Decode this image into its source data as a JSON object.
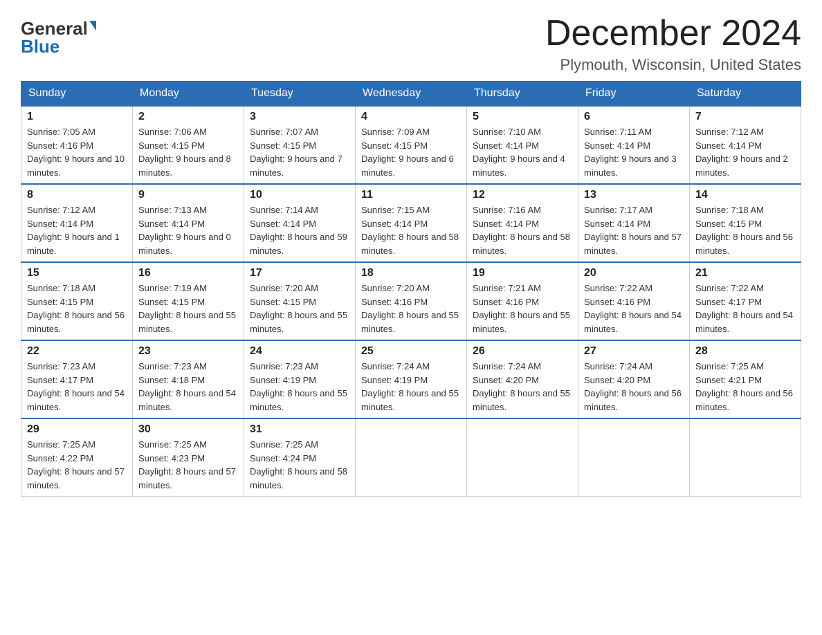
{
  "logo": {
    "general": "General",
    "blue": "Blue"
  },
  "title": {
    "month": "December 2024",
    "location": "Plymouth, Wisconsin, United States"
  },
  "headers": [
    "Sunday",
    "Monday",
    "Tuesday",
    "Wednesday",
    "Thursday",
    "Friday",
    "Saturday"
  ],
  "weeks": [
    [
      {
        "day": "1",
        "sunrise": "Sunrise: 7:05 AM",
        "sunset": "Sunset: 4:16 PM",
        "daylight": "Daylight: 9 hours and 10 minutes."
      },
      {
        "day": "2",
        "sunrise": "Sunrise: 7:06 AM",
        "sunset": "Sunset: 4:15 PM",
        "daylight": "Daylight: 9 hours and 8 minutes."
      },
      {
        "day": "3",
        "sunrise": "Sunrise: 7:07 AM",
        "sunset": "Sunset: 4:15 PM",
        "daylight": "Daylight: 9 hours and 7 minutes."
      },
      {
        "day": "4",
        "sunrise": "Sunrise: 7:09 AM",
        "sunset": "Sunset: 4:15 PM",
        "daylight": "Daylight: 9 hours and 6 minutes."
      },
      {
        "day": "5",
        "sunrise": "Sunrise: 7:10 AM",
        "sunset": "Sunset: 4:14 PM",
        "daylight": "Daylight: 9 hours and 4 minutes."
      },
      {
        "day": "6",
        "sunrise": "Sunrise: 7:11 AM",
        "sunset": "Sunset: 4:14 PM",
        "daylight": "Daylight: 9 hours and 3 minutes."
      },
      {
        "day": "7",
        "sunrise": "Sunrise: 7:12 AM",
        "sunset": "Sunset: 4:14 PM",
        "daylight": "Daylight: 9 hours and 2 minutes."
      }
    ],
    [
      {
        "day": "8",
        "sunrise": "Sunrise: 7:12 AM",
        "sunset": "Sunset: 4:14 PM",
        "daylight": "Daylight: 9 hours and 1 minute."
      },
      {
        "day": "9",
        "sunrise": "Sunrise: 7:13 AM",
        "sunset": "Sunset: 4:14 PM",
        "daylight": "Daylight: 9 hours and 0 minutes."
      },
      {
        "day": "10",
        "sunrise": "Sunrise: 7:14 AM",
        "sunset": "Sunset: 4:14 PM",
        "daylight": "Daylight: 8 hours and 59 minutes."
      },
      {
        "day": "11",
        "sunrise": "Sunrise: 7:15 AM",
        "sunset": "Sunset: 4:14 PM",
        "daylight": "Daylight: 8 hours and 58 minutes."
      },
      {
        "day": "12",
        "sunrise": "Sunrise: 7:16 AM",
        "sunset": "Sunset: 4:14 PM",
        "daylight": "Daylight: 8 hours and 58 minutes."
      },
      {
        "day": "13",
        "sunrise": "Sunrise: 7:17 AM",
        "sunset": "Sunset: 4:14 PM",
        "daylight": "Daylight: 8 hours and 57 minutes."
      },
      {
        "day": "14",
        "sunrise": "Sunrise: 7:18 AM",
        "sunset": "Sunset: 4:15 PM",
        "daylight": "Daylight: 8 hours and 56 minutes."
      }
    ],
    [
      {
        "day": "15",
        "sunrise": "Sunrise: 7:18 AM",
        "sunset": "Sunset: 4:15 PM",
        "daylight": "Daylight: 8 hours and 56 minutes."
      },
      {
        "day": "16",
        "sunrise": "Sunrise: 7:19 AM",
        "sunset": "Sunset: 4:15 PM",
        "daylight": "Daylight: 8 hours and 55 minutes."
      },
      {
        "day": "17",
        "sunrise": "Sunrise: 7:20 AM",
        "sunset": "Sunset: 4:15 PM",
        "daylight": "Daylight: 8 hours and 55 minutes."
      },
      {
        "day": "18",
        "sunrise": "Sunrise: 7:20 AM",
        "sunset": "Sunset: 4:16 PM",
        "daylight": "Daylight: 8 hours and 55 minutes."
      },
      {
        "day": "19",
        "sunrise": "Sunrise: 7:21 AM",
        "sunset": "Sunset: 4:16 PM",
        "daylight": "Daylight: 8 hours and 55 minutes."
      },
      {
        "day": "20",
        "sunrise": "Sunrise: 7:22 AM",
        "sunset": "Sunset: 4:16 PM",
        "daylight": "Daylight: 8 hours and 54 minutes."
      },
      {
        "day": "21",
        "sunrise": "Sunrise: 7:22 AM",
        "sunset": "Sunset: 4:17 PM",
        "daylight": "Daylight: 8 hours and 54 minutes."
      }
    ],
    [
      {
        "day": "22",
        "sunrise": "Sunrise: 7:23 AM",
        "sunset": "Sunset: 4:17 PM",
        "daylight": "Daylight: 8 hours and 54 minutes."
      },
      {
        "day": "23",
        "sunrise": "Sunrise: 7:23 AM",
        "sunset": "Sunset: 4:18 PM",
        "daylight": "Daylight: 8 hours and 54 minutes."
      },
      {
        "day": "24",
        "sunrise": "Sunrise: 7:23 AM",
        "sunset": "Sunset: 4:19 PM",
        "daylight": "Daylight: 8 hours and 55 minutes."
      },
      {
        "day": "25",
        "sunrise": "Sunrise: 7:24 AM",
        "sunset": "Sunset: 4:19 PM",
        "daylight": "Daylight: 8 hours and 55 minutes."
      },
      {
        "day": "26",
        "sunrise": "Sunrise: 7:24 AM",
        "sunset": "Sunset: 4:20 PM",
        "daylight": "Daylight: 8 hours and 55 minutes."
      },
      {
        "day": "27",
        "sunrise": "Sunrise: 7:24 AM",
        "sunset": "Sunset: 4:20 PM",
        "daylight": "Daylight: 8 hours and 56 minutes."
      },
      {
        "day": "28",
        "sunrise": "Sunrise: 7:25 AM",
        "sunset": "Sunset: 4:21 PM",
        "daylight": "Daylight: 8 hours and 56 minutes."
      }
    ],
    [
      {
        "day": "29",
        "sunrise": "Sunrise: 7:25 AM",
        "sunset": "Sunset: 4:22 PM",
        "daylight": "Daylight: 8 hours and 57 minutes."
      },
      {
        "day": "30",
        "sunrise": "Sunrise: 7:25 AM",
        "sunset": "Sunset: 4:23 PM",
        "daylight": "Daylight: 8 hours and 57 minutes."
      },
      {
        "day": "31",
        "sunrise": "Sunrise: 7:25 AM",
        "sunset": "Sunset: 4:24 PM",
        "daylight": "Daylight: 8 hours and 58 minutes."
      },
      null,
      null,
      null,
      null
    ]
  ]
}
